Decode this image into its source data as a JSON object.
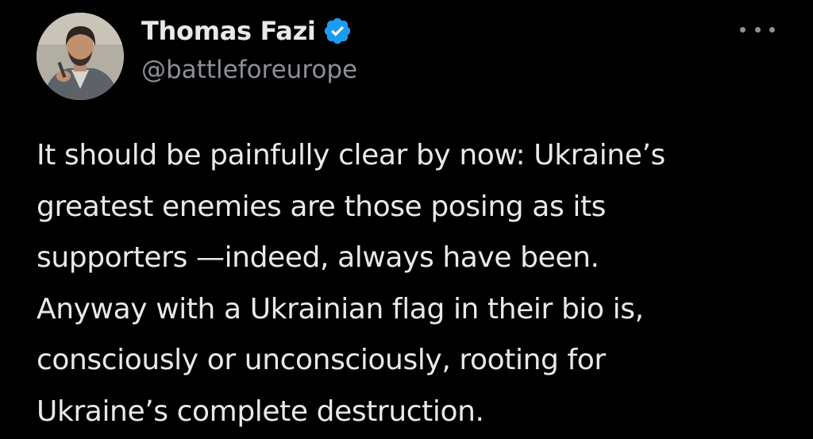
{
  "tweet": {
    "author": {
      "display_name": "Thomas Fazi",
      "handle": "@battleforeurope",
      "verified": true,
      "avatar_icon": "user-photo-avatar"
    },
    "more_icon": "ellipsis-horizontal-icon",
    "text_lines": [
      "It should be painfully clear by now: Ukraine’s",
      "greatest enemies are those posing as its",
      "supporters —indeed, always have been.",
      "Anyway with a Ukrainian flag in their bio is,",
      "consciously or unconsciously, rooting for",
      "Ukraine’s complete destruction."
    ]
  },
  "colors": {
    "background": "#000000",
    "primary_text": "#e7e9ea",
    "secondary_text": "#8b9096",
    "verified_blue": "#1d9bf0"
  }
}
